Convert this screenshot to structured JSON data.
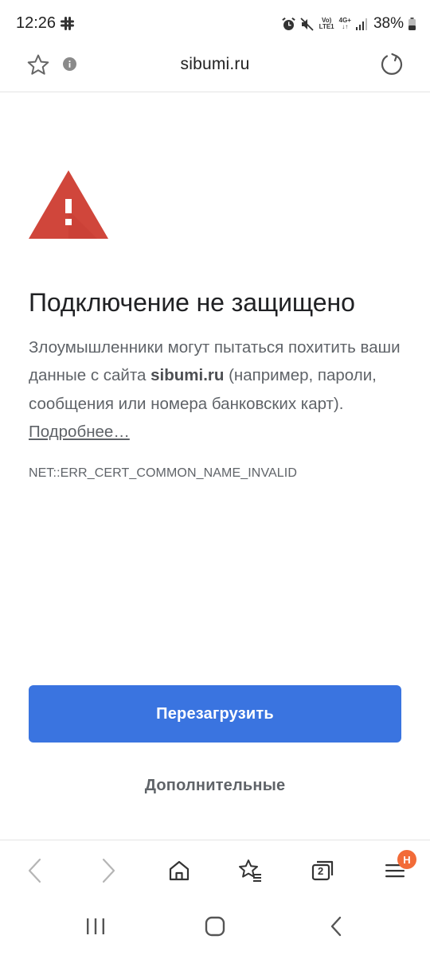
{
  "status_bar": {
    "time": "12:26",
    "network_top": "Vo)",
    "network_bottom": "LTE1",
    "data_type": "4G+",
    "battery_percent": "38%"
  },
  "address_bar": {
    "url": "sibumi.ru",
    "icons": [
      "star-icon",
      "info-icon",
      "reload-icon"
    ]
  },
  "error_page": {
    "title": "Подключение не защищено",
    "description_part1": "Злоумышленники могут пытаться похитить ваши данные с сайта ",
    "site": "sibumi.ru",
    "description_part2": " (например, пароли, сообщения или номера банковских карт). ",
    "details_link": "Подробнее…",
    "error_code": "NET::ERR_CERT_COMMON_NAME_INVALID",
    "reload_button": "Перезагрузить",
    "advanced_button": "Дополнительные",
    "accent_color": "#3a74e0",
    "warning_color": "#d0463b"
  },
  "browser_toolbar": {
    "tab_count": "2",
    "menu_badge": "H",
    "icons": [
      "back-icon",
      "forward-icon",
      "home-icon",
      "bookmarks-icon",
      "tabs-icon",
      "menu-icon"
    ]
  },
  "system_nav": {
    "icons": [
      "recents-icon",
      "home-nav-icon",
      "back-nav-icon"
    ]
  }
}
